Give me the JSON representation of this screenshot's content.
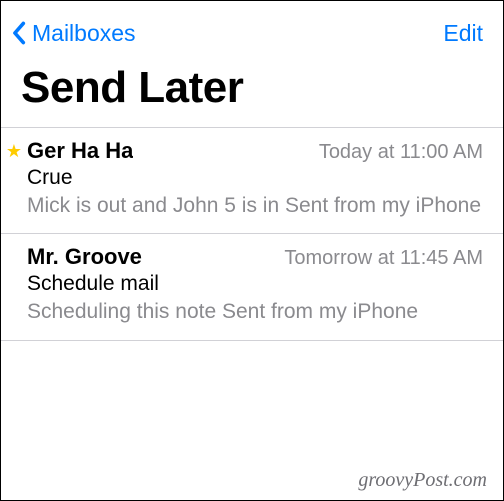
{
  "nav": {
    "back_label": "Mailboxes",
    "edit_label": "Edit"
  },
  "page": {
    "title": "Send Later"
  },
  "messages": [
    {
      "starred": true,
      "sender": "Ger Ha Ha",
      "time": "Today at 11:00 AM",
      "subject": "Crue",
      "preview": "Mick is out and John 5 is in Sent from my iPhone"
    },
    {
      "starred": false,
      "sender": "Mr. Groove",
      "time": "Tomorrow at 11:45 AM",
      "subject": "Schedule mail",
      "preview": "Scheduling this note Sent from my iPhone"
    }
  ],
  "watermark": "groovyPost.com"
}
